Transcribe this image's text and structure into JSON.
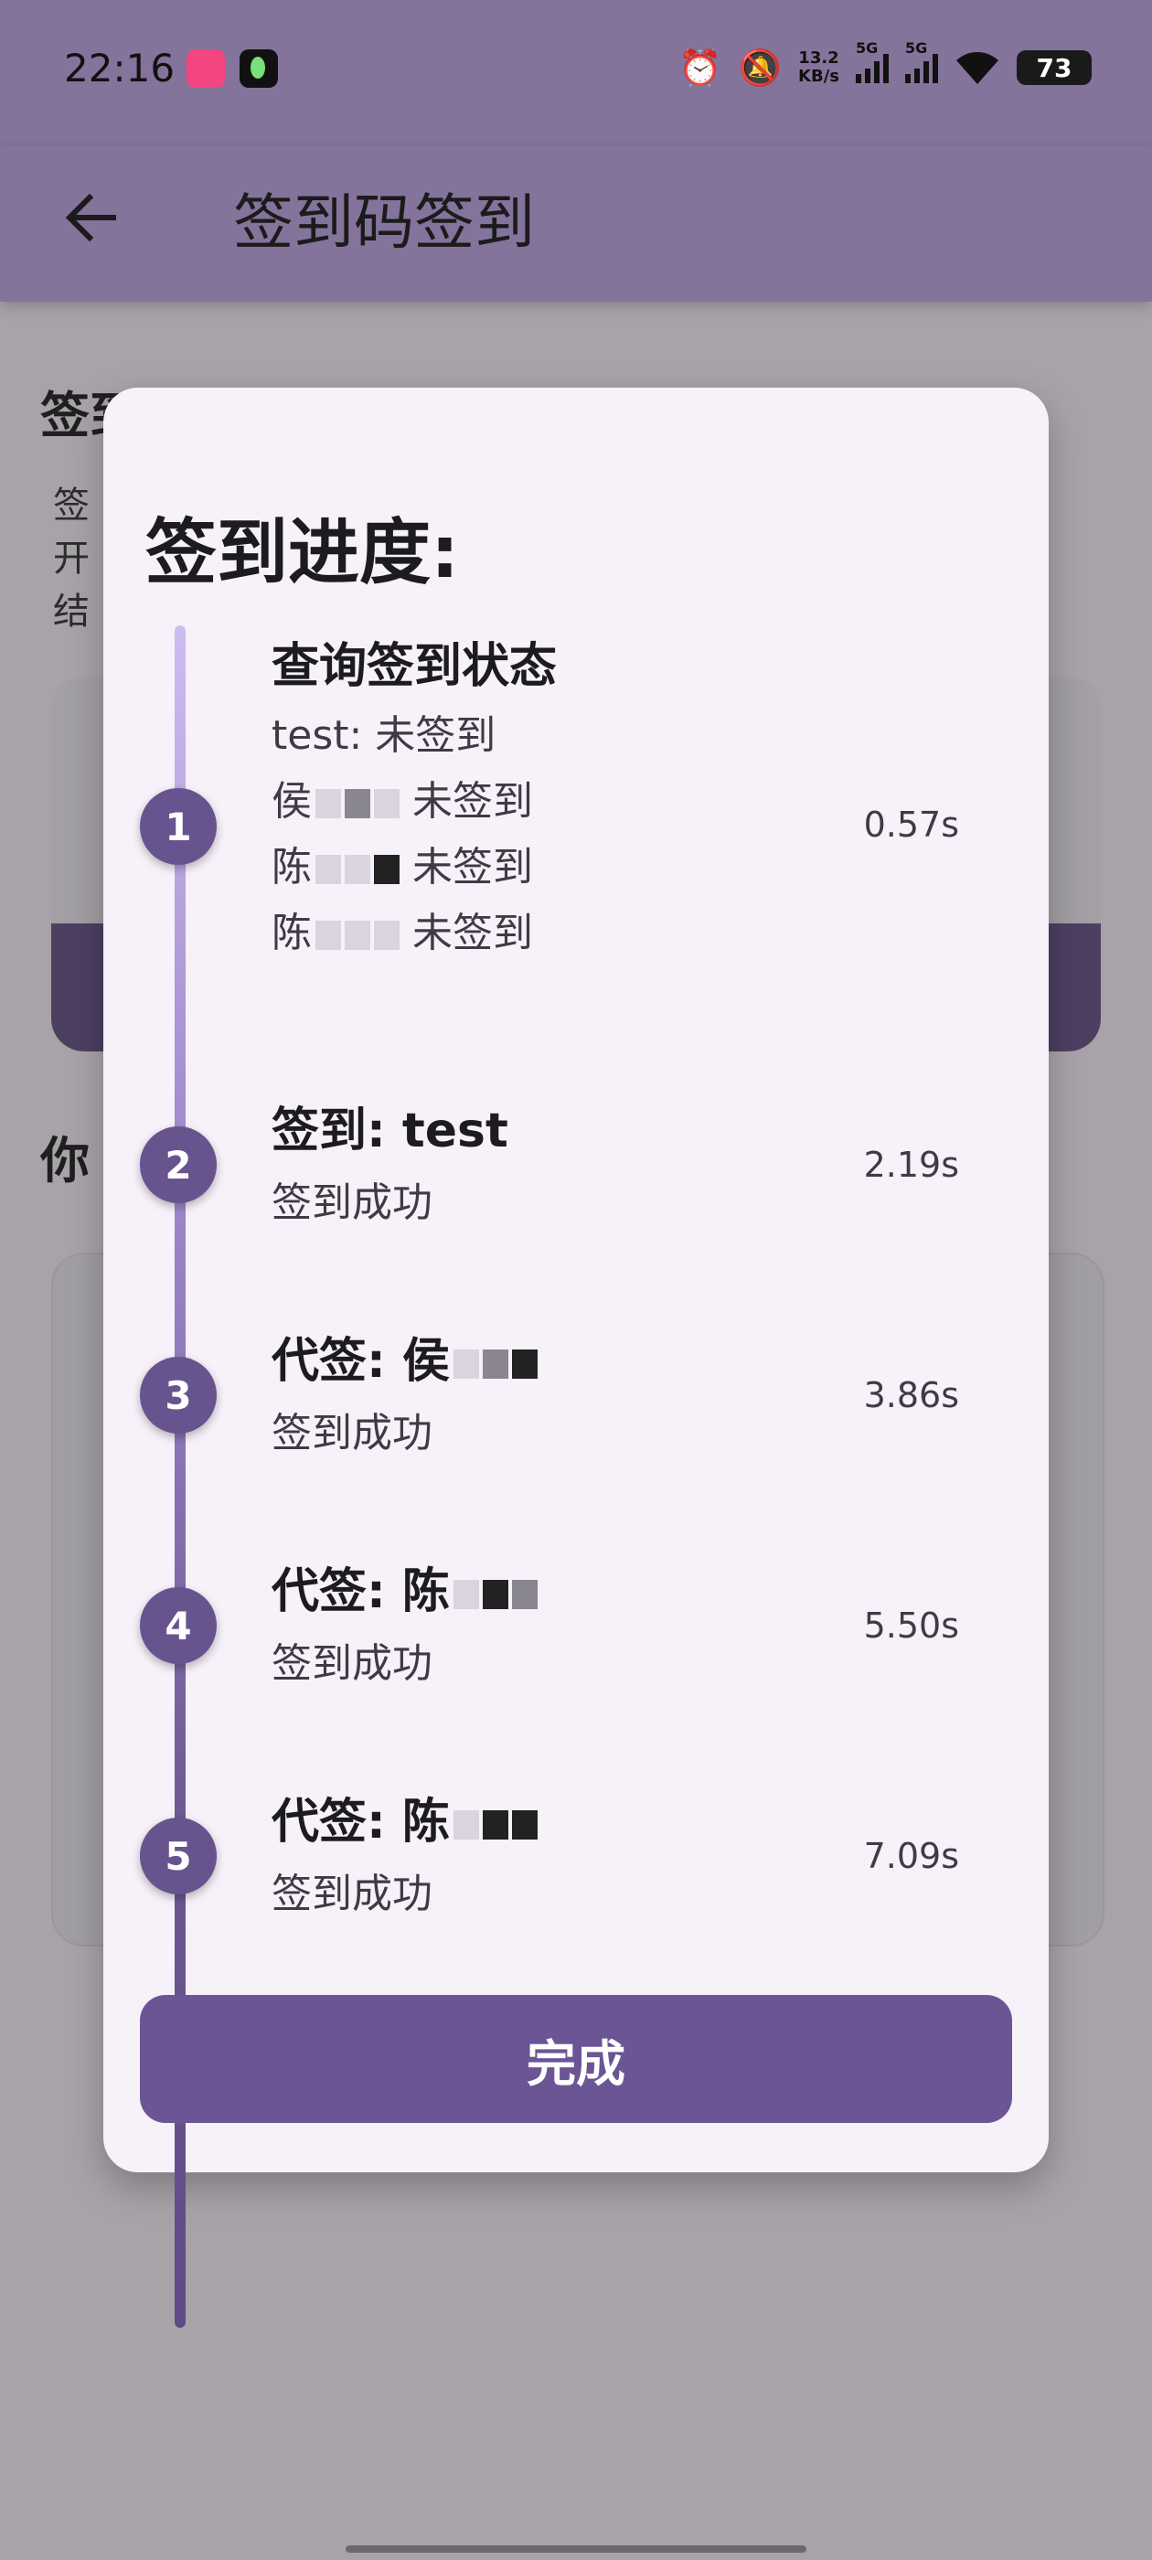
{
  "status_bar": {
    "time": "22:16",
    "network_speed": "13.2",
    "network_speed_unit": "KB/s",
    "signal1_label": "5G",
    "signal2_label": "5G",
    "battery": "73"
  },
  "app_bar": {
    "title": "签到码签到"
  },
  "background": {
    "heading1": "签到信息",
    "line1": "签",
    "line2": "开",
    "line3": "结",
    "heading2": "你"
  },
  "dialog": {
    "title": "签到进度:",
    "steps": [
      {
        "number": "1",
        "title": "查询签到状态",
        "lines": [
          "test: 未签到",
          "侯",
          "陈",
          "陈"
        ],
        "status_suffix": "未签到",
        "time": "0.57s"
      },
      {
        "number": "2",
        "title": "签到: test",
        "lines": [
          "签到成功"
        ],
        "time": "2.19s"
      },
      {
        "number": "3",
        "title": "代签: 侯",
        "lines": [
          "签到成功"
        ],
        "time": "3.86s"
      },
      {
        "number": "4",
        "title": "代签: 陈",
        "lines": [
          "签到成功"
        ],
        "time": "5.50s"
      },
      {
        "number": "5",
        "title": "代签: 陈",
        "lines": [
          "签到成功"
        ],
        "time": "7.09s"
      }
    ],
    "done_button": "完成"
  }
}
